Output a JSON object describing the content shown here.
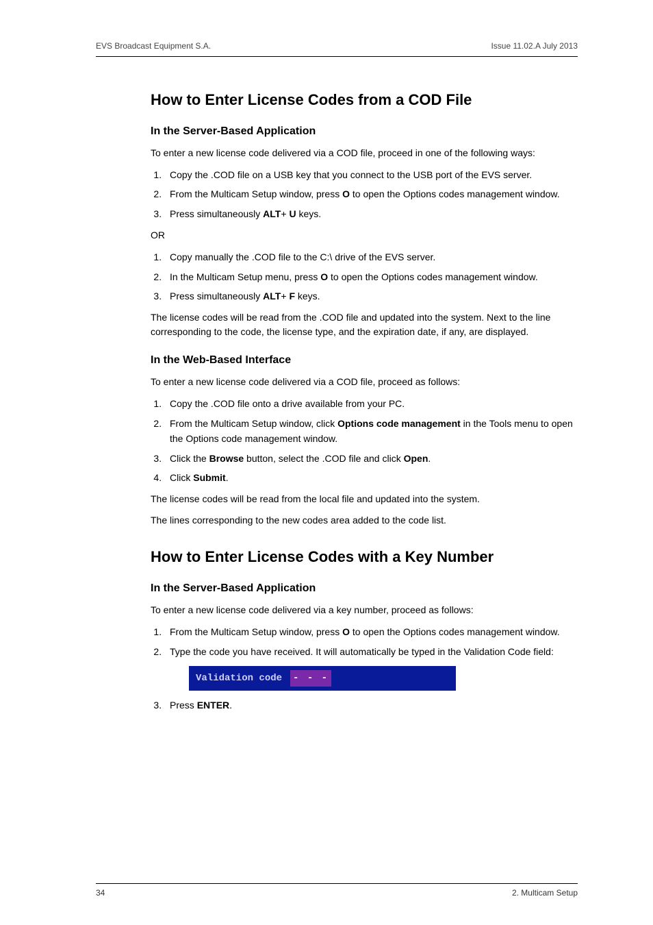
{
  "header": {
    "left": "EVS Broadcast Equipment S.A.",
    "right": "Issue 11.02.A   July 2013"
  },
  "section1": {
    "title": "How to Enter License Codes from a COD File",
    "sub1": {
      "title": "In the Server-Based Application",
      "intro": "To enter a new license code delivered via a COD file, proceed in one of the following ways:",
      "steps_a": {
        "s1": "Copy the .COD file on a USB key that you connect to the USB port of the EVS server.",
        "s2_pre": "From the Multicam Setup window, press ",
        "s2_bold": "O",
        "s2_post": " to open the Options codes management window.",
        "s3_pre": "Press simultaneously ",
        "s3_bold1": "ALT",
        "s3_mid": "+ ",
        "s3_bold2": "U",
        "s3_post": " keys."
      },
      "or": "OR",
      "steps_b": {
        "s1": "Copy manually the .COD file to the C:\\ drive of the EVS server.",
        "s2_pre": "In the Multicam Setup menu, press ",
        "s2_bold": "O",
        "s2_post": " to open the Options codes management window.",
        "s3_pre": "Press simultaneously ",
        "s3_bold1": "ALT",
        "s3_mid": "+ ",
        "s3_bold2": "F",
        "s3_post": " keys."
      },
      "outro": "The license codes will be read from the .COD file and updated into the system. Next to the line corresponding to the code, the license type, and the expiration date, if any, are displayed."
    },
    "sub2": {
      "title": "In the Web-Based Interface",
      "intro": "To enter a new license code delivered via a COD file, proceed as follows:",
      "steps": {
        "s1": "Copy the .COD file onto a drive available from your PC.",
        "s2_pre": "From the Multicam Setup window, click ",
        "s2_bold": "Options code management",
        "s2_post": " in the Tools menu to open the Options code management window.",
        "s3_pre": "Click the ",
        "s3_bold1": "Browse",
        "s3_mid": " button, select the .COD file and click ",
        "s3_bold2": "Open",
        "s3_post": ".",
        "s4_pre": "Click ",
        "s4_bold": "Submit",
        "s4_post": "."
      },
      "outro1": "The license codes will be read from the local file and updated into the system.",
      "outro2": "The lines corresponding to the new codes area added to the code list."
    }
  },
  "section2": {
    "title": "How to Enter License Codes with a Key Number",
    "sub1": {
      "title": "In the Server-Based Application",
      "intro": "To enter a new license code delivered via a key number, proceed as follows:",
      "steps": {
        "s1_pre": "From the Multicam Setup window, press ",
        "s1_bold": "O",
        "s1_post": " to open the Options codes management window.",
        "s2": "Type the code you have received. It will automatically be typed in the Validation Code field:",
        "s3_pre": "Press ",
        "s3_bold": "ENTER",
        "s3_post": "."
      },
      "validation": {
        "label": "Validation code",
        "value": "    -    -    -    "
      }
    }
  },
  "footer": {
    "left": "34",
    "right": "2. Multicam Setup"
  }
}
